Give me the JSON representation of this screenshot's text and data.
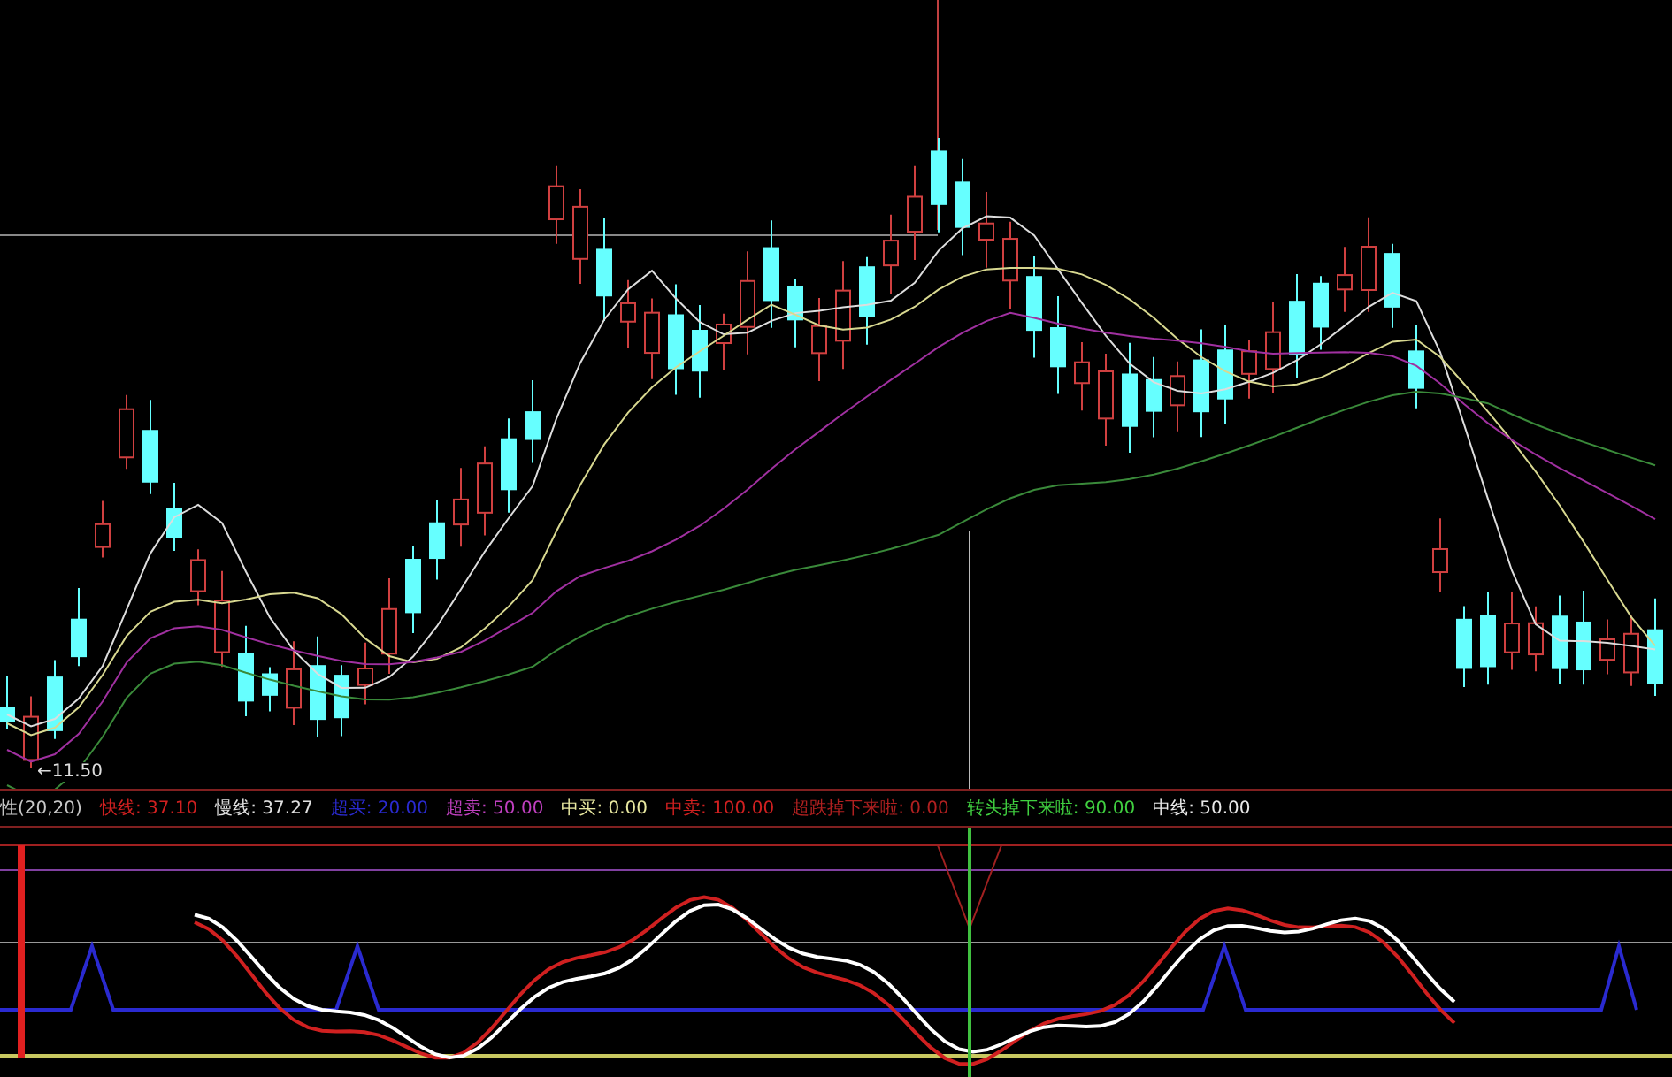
{
  "main_chart": {
    "low_marker": "←11.50"
  },
  "indicator": {
    "legend": [
      {
        "kind": "title",
        "label": "性(20,20)",
        "color": "#c8c8c8"
      },
      {
        "kind": "value",
        "label": "快线:",
        "value": "37.10",
        "color": "#d02020"
      },
      {
        "kind": "value",
        "label": "慢线:",
        "value": "37.27",
        "color": "#e0e0e0"
      },
      {
        "kind": "value",
        "label": "超买:",
        "value": "20.00",
        "color": "#2a2ad0"
      },
      {
        "kind": "value",
        "label": "超卖:",
        "value": "50.00",
        "color": "#c040c0"
      },
      {
        "kind": "value",
        "label": "中买:",
        "value": "0.00",
        "color": "#e8e8a0"
      },
      {
        "kind": "value",
        "label": "中卖:",
        "value": "100.00",
        "color": "#d02020"
      },
      {
        "kind": "value",
        "label": "超跌掉下来啦:",
        "value": "0.00",
        "color": "#b02020"
      },
      {
        "kind": "value",
        "label": "转头掉下来啦:",
        "value": "90.00",
        "color": "#40d040"
      },
      {
        "kind": "value",
        "label": "中线:",
        "value": "50.00",
        "color": "#e8e8e8"
      }
    ]
  }
}
